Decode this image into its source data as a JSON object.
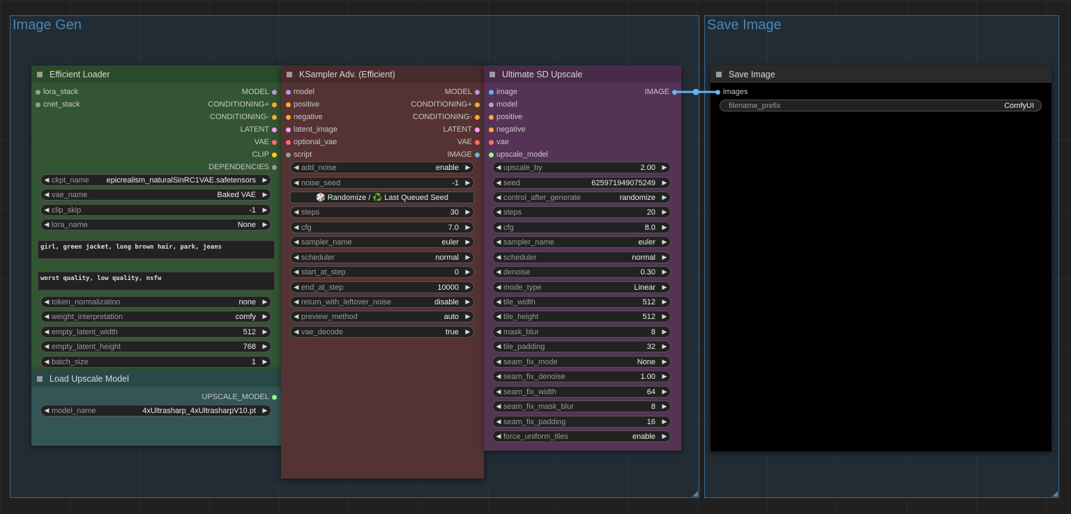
{
  "groups": {
    "image_gen": "Image Gen",
    "save_image": "Save Image"
  },
  "efficient_loader": {
    "title": "Efficient Loader",
    "inputs": [
      "lora_stack",
      "cnet_stack"
    ],
    "outputs": [
      "MODEL",
      "CONDITIONING+",
      "CONDITIONING-",
      "LATENT",
      "VAE",
      "CLIP",
      "DEPENDENCIES"
    ],
    "widgets": [
      {
        "label": "ckpt_name",
        "value": "epicrealism_naturalSinRC1VAE.safetensors"
      },
      {
        "label": "vae_name",
        "value": "Baked VAE"
      },
      {
        "label": "clip_skip",
        "value": "-1"
      },
      {
        "label": "lora_name",
        "value": "None"
      }
    ],
    "positive_prompt": "girl, green jacket, long brown hair, park, jeans",
    "negative_prompt": "worst quality, low quality, nsfw",
    "widgets2": [
      {
        "label": "token_normalization",
        "value": "none"
      },
      {
        "label": "weight_interpretation",
        "value": "comfy"
      },
      {
        "label": "empty_latent_width",
        "value": "512"
      },
      {
        "label": "empty_latent_height",
        "value": "768"
      },
      {
        "label": "batch_size",
        "value": "1"
      }
    ]
  },
  "load_upscale": {
    "title": "Load Upscale Model",
    "output": "UPSCALE_MODEL",
    "widget": {
      "label": "model_name",
      "value": "4xUltrasharp_4xUltrasharpV10.pt"
    }
  },
  "ksampler": {
    "title": "KSampler Adv. (Efficient)",
    "inputs": [
      "model",
      "positive",
      "negative",
      "latent_image",
      "optional_vae",
      "script"
    ],
    "outputs": [
      "MODEL",
      "CONDITIONING+",
      "CONDITIONING-",
      "LATENT",
      "VAE",
      "IMAGE"
    ],
    "widgets_a": [
      {
        "label": "add_noise",
        "value": "enable"
      },
      {
        "label": "noise_seed",
        "value": "-1"
      }
    ],
    "seed_button": "🎲 Randomize / ♻️ Last Queued Seed",
    "widgets_b": [
      {
        "label": "steps",
        "value": "30"
      },
      {
        "label": "cfg",
        "value": "7.0"
      },
      {
        "label": "sampler_name",
        "value": "euler"
      },
      {
        "label": "scheduler",
        "value": "normal"
      },
      {
        "label": "start_at_step",
        "value": "0"
      },
      {
        "label": "end_at_step",
        "value": "10000"
      },
      {
        "label": "return_with_leftover_noise",
        "value": "disable"
      },
      {
        "label": "preview_method",
        "value": "auto"
      },
      {
        "label": "vae_decode",
        "value": "true"
      }
    ]
  },
  "upscale": {
    "title": "Ultimate SD Upscale",
    "inputs": [
      "image",
      "model",
      "positive",
      "negative",
      "vae",
      "upscale_model"
    ],
    "output": "IMAGE",
    "widgets": [
      {
        "label": "upscale_by",
        "value": "2.00"
      },
      {
        "label": "seed",
        "value": "625971949075249"
      },
      {
        "label": "control_after_generate",
        "value": "randomize"
      },
      {
        "label": "steps",
        "value": "20"
      },
      {
        "label": "cfg",
        "value": "8.0"
      },
      {
        "label": "sampler_name",
        "value": "euler"
      },
      {
        "label": "scheduler",
        "value": "normal"
      },
      {
        "label": "denoise",
        "value": "0.30"
      },
      {
        "label": "mode_type",
        "value": "Linear"
      },
      {
        "label": "tile_width",
        "value": "512"
      },
      {
        "label": "tile_height",
        "value": "512"
      },
      {
        "label": "mask_blur",
        "value": "8"
      },
      {
        "label": "tile_padding",
        "value": "32"
      },
      {
        "label": "seam_fix_mode",
        "value": "None"
      },
      {
        "label": "seam_fix_denoise",
        "value": "1.00"
      },
      {
        "label": "seam_fix_width",
        "value": "64"
      },
      {
        "label": "seam_fix_mask_blur",
        "value": "8"
      },
      {
        "label": "seam_fix_padding",
        "value": "16"
      },
      {
        "label": "force_uniform_tiles",
        "value": "enable"
      }
    ]
  },
  "save_image": {
    "title": "Save Image",
    "input": "images",
    "widget": {
      "label": "filename_prefix",
      "value": "ComfyUI"
    }
  },
  "colors": {
    "model": "#b39ddb",
    "conditioning": "#ffa931",
    "latent": "#ff9cf9",
    "vae": "#ff6e6e",
    "clip": "#ffd500",
    "image": "#64b5f6",
    "upscale_model": "#8bff8b",
    "generic": "#999999"
  }
}
